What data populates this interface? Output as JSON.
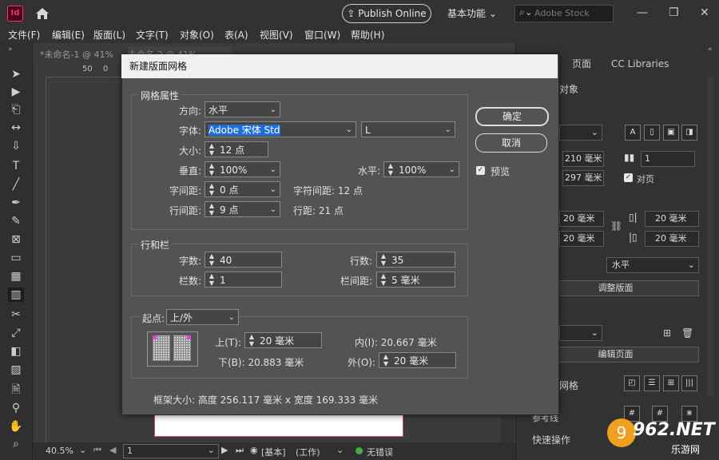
{
  "app": {
    "logo": "Id",
    "publish_button": "Publish Online",
    "workspace": "基本功能",
    "stock_placeholder": "Adobe Stock"
  },
  "menu": [
    "文件(F)",
    "编辑(E)",
    "版面(L)",
    "文字(T)",
    "对象(O)",
    "表(A)",
    "视图(V)",
    "窗口(W)",
    "帮助(H)"
  ],
  "doc_tabs": [
    "*未命名-1 @ 41%",
    "未命名-2 @ 41%"
  ],
  "ruler_marks": [
    "50",
    "0"
  ],
  "status": {
    "zoom": "40.5%",
    "page": "1",
    "mode": "[基本]",
    "state": "(工作)",
    "errors": "无错误"
  },
  "right_panel": {
    "tabs": [
      "页面",
      "CC Libraries"
    ],
    "section_object": "对象",
    "width": "210 毫米",
    "height": "297 毫米",
    "pages": "1",
    "facing_label": "对页",
    "margin_top": "20 毫米",
    "margin_bottom": "20 毫米",
    "margin_in": "20 毫米",
    "margin_out": "20 毫米",
    "orientation": "水平",
    "adjust_layout": "调整版面",
    "edit_page": "编辑页面",
    "grid_label": "网格",
    "guides_label": "参考线",
    "quick_actions": "快速操作"
  },
  "dialog": {
    "title": "新建版面网格",
    "ok": "确定",
    "cancel": "取消",
    "preview": "预览",
    "grid_props": {
      "section": "网格属性",
      "direction_label": "方向:",
      "direction": "水平",
      "font_label": "字体:",
      "font": "Adobe 宋体 Std",
      "font_style": "L",
      "size_label": "大小:",
      "size": "12 点",
      "vertical_label": "垂直:",
      "vertical": "100%",
      "horizontal_label": "水平:",
      "horizontal": "100%",
      "char_space_label": "字间距:",
      "char_space": "0 点",
      "char_pitch": "字符间距: 12 点",
      "line_space_label": "行间距:",
      "line_space": "9 点",
      "line_pitch": "行距: 21 点"
    },
    "rows_cols": {
      "section": "行和栏",
      "chars_label": "字数:",
      "chars": "40",
      "rows_label": "行数:",
      "rows": "35",
      "cols_label": "栏数:",
      "cols": "1",
      "gutter_label": "栏间距:",
      "gutter": "5 毫米"
    },
    "start": {
      "label": "起点:",
      "value": "上/外",
      "top_label": "上(T):",
      "top": "20 毫米",
      "inside": "内(I): 20.667 毫米",
      "bottom": "下(B): 20.883 毫米",
      "outside_label": "外(O):",
      "outside": "20 毫米"
    },
    "frame_size": "框架大小: 高度 256.117 毫米 x 宽度 169.333 毫米"
  },
  "watermark": {
    "main": "962.NET",
    "sub": "乐游网"
  },
  "colors": {
    "accent": "#1e6fd9",
    "ok_green": "#3cb043",
    "page_border": "#d0506e"
  }
}
